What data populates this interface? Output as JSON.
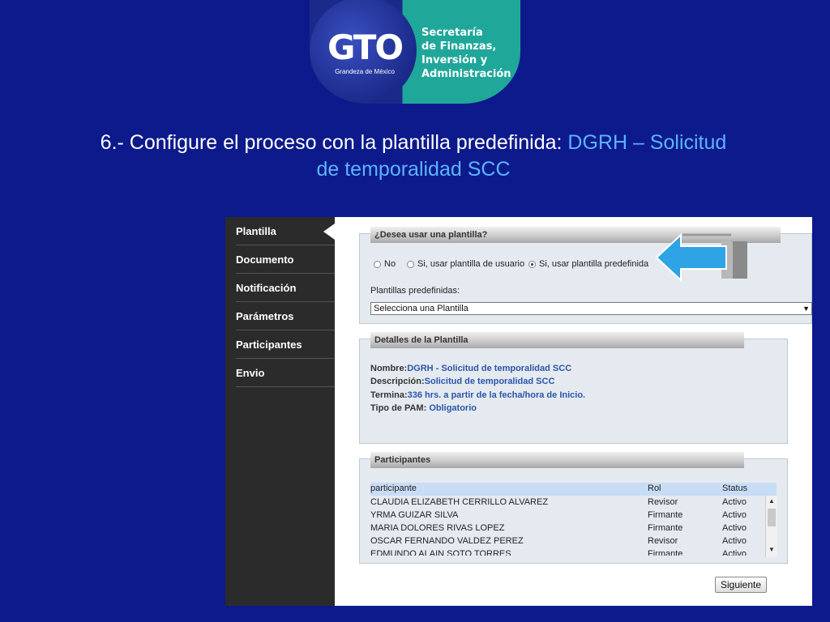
{
  "logo": {
    "brand": "GTO",
    "tagline": "Grandeza de México",
    "org_lines": [
      "Secretaría",
      "de Finanzas,",
      "Inversión y",
      "Administración"
    ]
  },
  "heading": {
    "prefix": "6.- Configure el proceso con la plantilla predefinida: ",
    "highlight_line1": "DGRH – Solicitud",
    "highlight_line2": "de temporalidad SCC"
  },
  "sidebar": {
    "items": [
      {
        "label": "Plantilla"
      },
      {
        "label": "Documento"
      },
      {
        "label": "Notificación"
      },
      {
        "label": "Parámetros"
      },
      {
        "label": "Participantes"
      },
      {
        "label": "Envio"
      }
    ]
  },
  "template_section": {
    "title": "¿Desea usar una plantilla?",
    "options": [
      {
        "label": "No",
        "selected": false
      },
      {
        "label": "Si, usar plantilla de usuario",
        "selected": false
      },
      {
        "label": "Si, usar plantilla predefinida",
        "selected": true
      }
    ],
    "select_label": "Plantillas predefinidas:",
    "select_value": "Selecciona una Plantilla"
  },
  "details_section": {
    "title": "Detalles de la Plantilla",
    "rows": [
      {
        "label": "Nombre:",
        "value": "DGRH - Solicitud de temporalidad SCC"
      },
      {
        "label": "Descripción:",
        "value": "Solicitud de temporalidad SCC"
      },
      {
        "label": "Termina:",
        "value": "336 hrs. a partir de la fecha/hora de Inicio."
      },
      {
        "label": "Tipo de PAM: ",
        "value": "Obligatorio"
      }
    ]
  },
  "participants_section": {
    "title": "Participantes",
    "columns": [
      "participante",
      "Rol",
      "Status"
    ],
    "rows": [
      [
        "CLAUDIA ELIZABETH CERRILLO ALVAREZ",
        "Revisor",
        "Activo"
      ],
      [
        "YRMA GUIZAR SILVA",
        "Firmante",
        "Activo"
      ],
      [
        "MARIA DOLORES RIVAS LOPEZ",
        "Firmante",
        "Activo"
      ],
      [
        "OSCAR FERNANDO VALDEZ PEREZ",
        "Revisor",
        "Activo"
      ],
      [
        "EDMUNDO ALAIN SOTO TORRES",
        "Firmante",
        "Activo"
      ]
    ]
  },
  "next_button": "Siguiente",
  "colors": {
    "background": "#0d1a8c",
    "highlight": "#5db3ff",
    "arrow": "#2ea4e6"
  }
}
